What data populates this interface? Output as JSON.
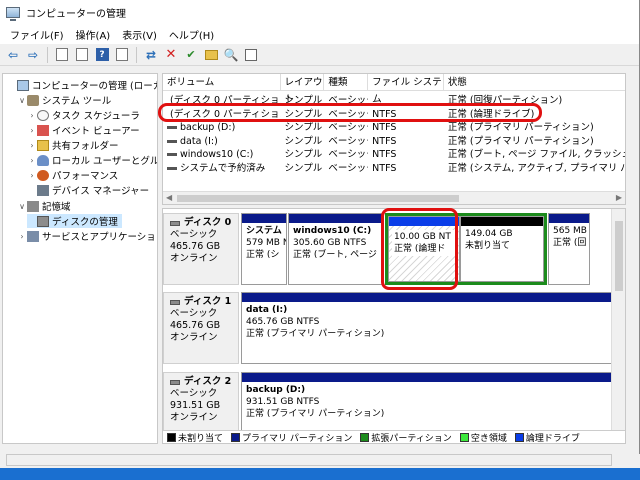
{
  "window": {
    "title": "コンピューターの管理"
  },
  "menu": [
    "ファイル(F)",
    "操作(A)",
    "表示(V)",
    "ヘルプ(H)"
  ],
  "toolbar": [
    {
      "name": "back-arrow-icon",
      "glyph": "⇦"
    },
    {
      "name": "forward-arrow-icon",
      "glyph": "⇨"
    },
    {
      "name": "up-folder-icon",
      "glyph": ""
    },
    {
      "name": "show-hide-tree-icon",
      "glyph": ""
    },
    {
      "name": "help-icon",
      "glyph": "?"
    },
    {
      "name": "view-icon",
      "glyph": ""
    },
    {
      "name": "connect-icon",
      "glyph": "⇄"
    },
    {
      "name": "delete-icon",
      "glyph": "✕"
    },
    {
      "name": "check-icon",
      "glyph": "✔"
    },
    {
      "name": "folder-up-icon",
      "glyph": ""
    },
    {
      "name": "search-icon",
      "glyph": "🔍"
    },
    {
      "name": "properties-icon",
      "glyph": ""
    }
  ],
  "tree": [
    {
      "label": "コンピューターの管理 (ローカル)",
      "level": 0,
      "exp": "",
      "icon": "ti-comp",
      "name": "tree-root"
    },
    {
      "label": "システム ツール",
      "level": 1,
      "exp": "∨",
      "icon": "ti-tools",
      "name": "tree-system-tools"
    },
    {
      "label": "タスク スケジューラ",
      "level": 2,
      "exp": "›",
      "icon": "ti-clock",
      "name": "tree-task-scheduler"
    },
    {
      "label": "イベント ビューアー",
      "level": 2,
      "exp": "›",
      "icon": "ti-ev",
      "name": "tree-event-viewer"
    },
    {
      "label": "共有フォルダー",
      "level": 2,
      "exp": "›",
      "icon": "ti-folder",
      "name": "tree-shared-folders"
    },
    {
      "label": "ローカル ユーザーとグループ",
      "level": 2,
      "exp": "›",
      "icon": "ti-users",
      "name": "tree-local-users"
    },
    {
      "label": "パフォーマンス",
      "level": 2,
      "exp": "›",
      "icon": "ti-perf",
      "name": "tree-performance"
    },
    {
      "label": "デバイス マネージャー",
      "level": 2,
      "exp": "",
      "icon": "ti-dev",
      "name": "tree-device-manager"
    },
    {
      "label": "記憶域",
      "level": 1,
      "exp": "∨",
      "icon": "ti-store",
      "name": "tree-storage"
    },
    {
      "label": "ディスクの管理",
      "level": 2,
      "exp": "",
      "icon": "ti-disk",
      "name": "tree-disk-management",
      "selected": true
    },
    {
      "label": "サービスとアプリケーション",
      "level": 1,
      "exp": "›",
      "icon": "ti-svc",
      "name": "tree-services-apps"
    }
  ],
  "volumes": {
    "headers": [
      "ボリューム",
      "レイアウト",
      "種類",
      "ファイル システム",
      "状態"
    ],
    "rows": [
      [
        "(ディスク 0 パーティション 3)",
        "シンプル",
        "ベーシック",
        "",
        "正常 (回復パーティション)"
      ],
      [
        "(ディスク 0 パーティション 4)",
        "シンプル",
        "ベーシック",
        "NTFS",
        "正常 (論理ドライブ)"
      ],
      [
        "backup (D:)",
        "シンプル",
        "ベーシック",
        "NTFS",
        "正常 (プライマリ パーティション)"
      ],
      [
        "data (I:)",
        "シンプル",
        "ベーシック",
        "NTFS",
        "正常 (プライマリ パーティション)"
      ],
      [
        "windows10 (C:)",
        "シンプル",
        "ベーシック",
        "NTFS",
        "正常 (ブート, ページ ファイル, クラッシュ ダンプ, プライ"
      ],
      [
        "システムで予約済み",
        "シンプル",
        "ベーシック",
        "NTFS",
        "正常 (システム, アクティブ, プライマリ パーティ"
      ]
    ]
  },
  "disks": [
    {
      "name": "ディスク 0",
      "type": "ベーシック",
      "size": "465.76 GB",
      "status": "オンライン",
      "parts": [
        {
          "bar": "primary",
          "lines": [
            "システム",
            "579 MB N",
            "正常 (シ"
          ],
          "bold0": true
        },
        {
          "bar": "primary",
          "lines": [
            "windows10 (C:)",
            "305.60 GB NTFS",
            "正常 (ブート, ページ フ"
          ],
          "bold0": true
        },
        {
          "bar": "logical",
          "lines": [
            "10.00 GB NT",
            "正常 (論理ド"
          ],
          "extended": true
        },
        {
          "bar": "unalloc",
          "lines": [
            "149.04 GB",
            "未割り当て"
          ],
          "extended": true
        },
        {
          "bar": "primary",
          "lines": [
            "565 MB",
            "正常 (回"
          ]
        }
      ]
    },
    {
      "name": "ディスク 1",
      "type": "ベーシック",
      "size": "465.76 GB",
      "status": "オンライン",
      "parts": [
        {
          "bar": "primary",
          "lines": [
            "data (I:)",
            "465.76 GB NTFS",
            "正常 (プライマリ パーティション)"
          ],
          "bold0": true
        }
      ]
    },
    {
      "name": "ディスク 2",
      "type": "ベーシック",
      "size": "931.51 GB",
      "status": "オンライン",
      "parts": [
        {
          "bar": "primary",
          "lines": [
            "backup (D:)",
            "931.51 GB NTFS",
            "正常 (プライマリ パーティション)"
          ],
          "bold0": true
        }
      ]
    }
  ],
  "legend": [
    {
      "label": "未割り当て",
      "color": "#000000"
    },
    {
      "label": "プライマリ パーティション",
      "color": "#0a1a8a"
    },
    {
      "label": "拡張パーティション",
      "color": "#1c8b1c"
    },
    {
      "label": "空き領域",
      "color": "#3ce83c"
    },
    {
      "label": "論理ドライブ",
      "color": "#0a3de8"
    }
  ]
}
